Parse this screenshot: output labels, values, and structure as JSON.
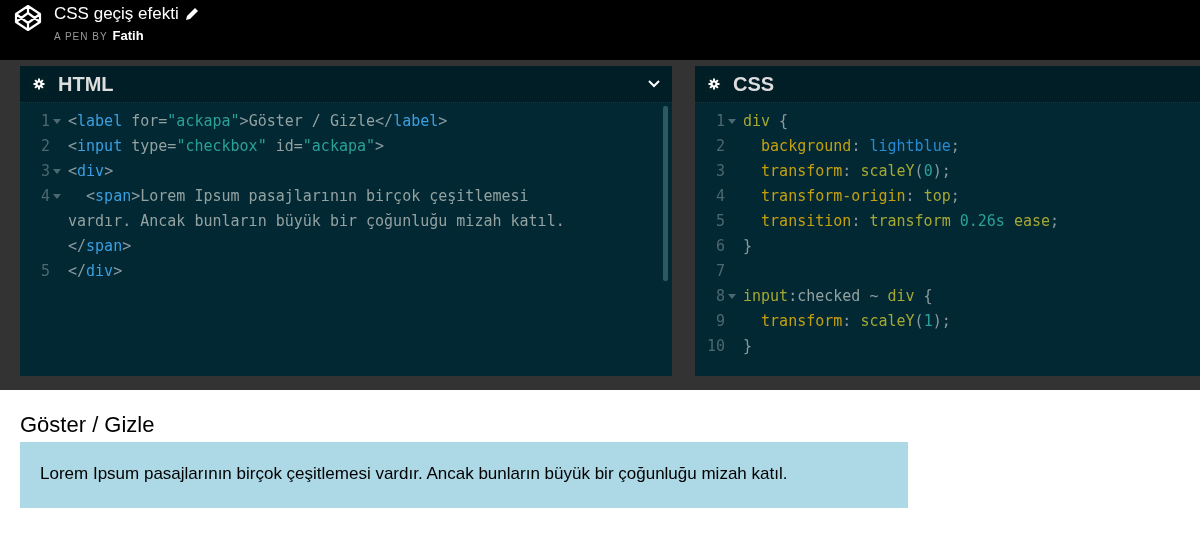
{
  "pen": {
    "title": "CSS geçiş efekti",
    "byline": "A PEN BY",
    "author": "Fatih"
  },
  "editors": [
    {
      "title": "HTML",
      "collapsible": true,
      "scrollbar": true,
      "lines": [
        {
          "number": "1",
          "fold": true,
          "rows": [
            [
              {
                "kind": "punct",
                "text": "<"
              },
              {
                "kind": "tag",
                "text": "label"
              },
              {
                "kind": "attr",
                "text": " for="
              },
              {
                "kind": "string",
                "text": "\"ackapa\""
              },
              {
                "kind": "punct",
                "text": ">"
              },
              {
                "kind": "text",
                "text": "Göster / Gizle"
              },
              {
                "kind": "punct",
                "text": "</"
              },
              {
                "kind": "tag",
                "text": "label"
              },
              {
                "kind": "punct",
                "text": ">"
              }
            ]
          ]
        },
        {
          "number": "2",
          "fold": false,
          "rows": [
            [
              {
                "kind": "punct",
                "text": "<"
              },
              {
                "kind": "tag",
                "text": "input"
              },
              {
                "kind": "attr",
                "text": " type="
              },
              {
                "kind": "string",
                "text": "\"checkbox\""
              },
              {
                "kind": "attr",
                "text": " id="
              },
              {
                "kind": "string",
                "text": "\"ackapa\""
              },
              {
                "kind": "punct",
                "text": ">"
              }
            ]
          ]
        },
        {
          "number": "3",
          "fold": true,
          "rows": [
            [
              {
                "kind": "punct",
                "text": "<"
              },
              {
                "kind": "tag",
                "text": "div"
              },
              {
                "kind": "punct",
                "text": ">"
              }
            ]
          ]
        },
        {
          "number": "4",
          "fold": true,
          "rows": [
            [
              {
                "kind": "punct",
                "text": "  <"
              },
              {
                "kind": "tag",
                "text": "span"
              },
              {
                "kind": "punct",
                "text": ">"
              },
              {
                "kind": "text",
                "text": "Lorem Ipsum pasajlarının birçok çeşitlemesi"
              },
              {
                "kind": "break"
              },
              {
                "kind": "text",
                "text": "vardır. Ancak bunların büyük bir çoğunluğu mizah katıl."
              },
              {
                "kind": "break"
              },
              {
                "kind": "punct",
                "text": "</"
              },
              {
                "kind": "tag",
                "text": "span"
              },
              {
                "kind": "punct",
                "text": ">"
              }
            ]
          ]
        },
        {
          "number": "5",
          "fold": false,
          "rows": [
            [
              {
                "kind": "punct",
                "text": "</"
              },
              {
                "kind": "tag",
                "text": "div"
              },
              {
                "kind": "punct",
                "text": ">"
              }
            ]
          ]
        }
      ]
    },
    {
      "title": "CSS",
      "collapsible": false,
      "scrollbar": false,
      "lines": [
        {
          "number": "1",
          "fold": true,
          "rows": [
            [
              {
                "kind": "selector",
                "text": "div"
              },
              {
                "kind": "punct",
                "text": " {"
              }
            ]
          ]
        },
        {
          "number": "2",
          "fold": false,
          "rows": [
            [
              {
                "kind": "property",
                "text": "  background"
              },
              {
                "kind": "punct",
                "text": ": "
              },
              {
                "kind": "keyword",
                "text": "lightblue"
              },
              {
                "kind": "punct",
                "text": ";"
              }
            ]
          ]
        },
        {
          "number": "3",
          "fold": false,
          "rows": [
            [
              {
                "kind": "property",
                "text": "  transform"
              },
              {
                "kind": "punct",
                "text": ": "
              },
              {
                "kind": "value",
                "text": "scaleY"
              },
              {
                "kind": "punct",
                "text": "("
              },
              {
                "kind": "number",
                "text": "0"
              },
              {
                "kind": "punct",
                "text": ");"
              }
            ]
          ]
        },
        {
          "number": "4",
          "fold": false,
          "rows": [
            [
              {
                "kind": "property",
                "text": "  transform-origin"
              },
              {
                "kind": "punct",
                "text": ": "
              },
              {
                "kind": "value",
                "text": "top"
              },
              {
                "kind": "punct",
                "text": ";"
              }
            ]
          ]
        },
        {
          "number": "5",
          "fold": false,
          "rows": [
            [
              {
                "kind": "property",
                "text": "  transition"
              },
              {
                "kind": "punct",
                "text": ": "
              },
              {
                "kind": "value",
                "text": "transform"
              },
              {
                "kind": "punct",
                "text": " "
              },
              {
                "kind": "number",
                "text": "0.26s"
              },
              {
                "kind": "punct",
                "text": " "
              },
              {
                "kind": "value",
                "text": "ease"
              },
              {
                "kind": "punct",
                "text": ";"
              }
            ]
          ]
        },
        {
          "number": "6",
          "fold": false,
          "rows": [
            [
              {
                "kind": "punct",
                "text": "}"
              }
            ]
          ]
        },
        {
          "number": "7",
          "fold": false,
          "rows": [
            []
          ]
        },
        {
          "number": "8",
          "fold": true,
          "rows": [
            [
              {
                "kind": "selector",
                "text": "input"
              },
              {
                "kind": "text",
                "text": ":checked"
              },
              {
                "kind": "punct",
                "text": " ~ "
              },
              {
                "kind": "selector",
                "text": "div"
              },
              {
                "kind": "punct",
                "text": " {"
              }
            ]
          ]
        },
        {
          "number": "9",
          "fold": false,
          "rows": [
            [
              {
                "kind": "property",
                "text": "  transform"
              },
              {
                "kind": "punct",
                "text": ": "
              },
              {
                "kind": "value",
                "text": "scaleY"
              },
              {
                "kind": "punct",
                "text": "("
              },
              {
                "kind": "number",
                "text": "1"
              },
              {
                "kind": "punct",
                "text": ");"
              }
            ]
          ]
        },
        {
          "number": "10",
          "fold": false,
          "rows": [
            [
              {
                "kind": "punct",
                "text": "}"
              }
            ]
          ]
        }
      ]
    }
  ],
  "result": {
    "label": "Göster / Gizle",
    "box_text": "Lorem Ipsum pasajlarının birçok çeşitlemesi vardır. Ancak bunların büyük bir çoğunluğu mizah katıl."
  }
}
